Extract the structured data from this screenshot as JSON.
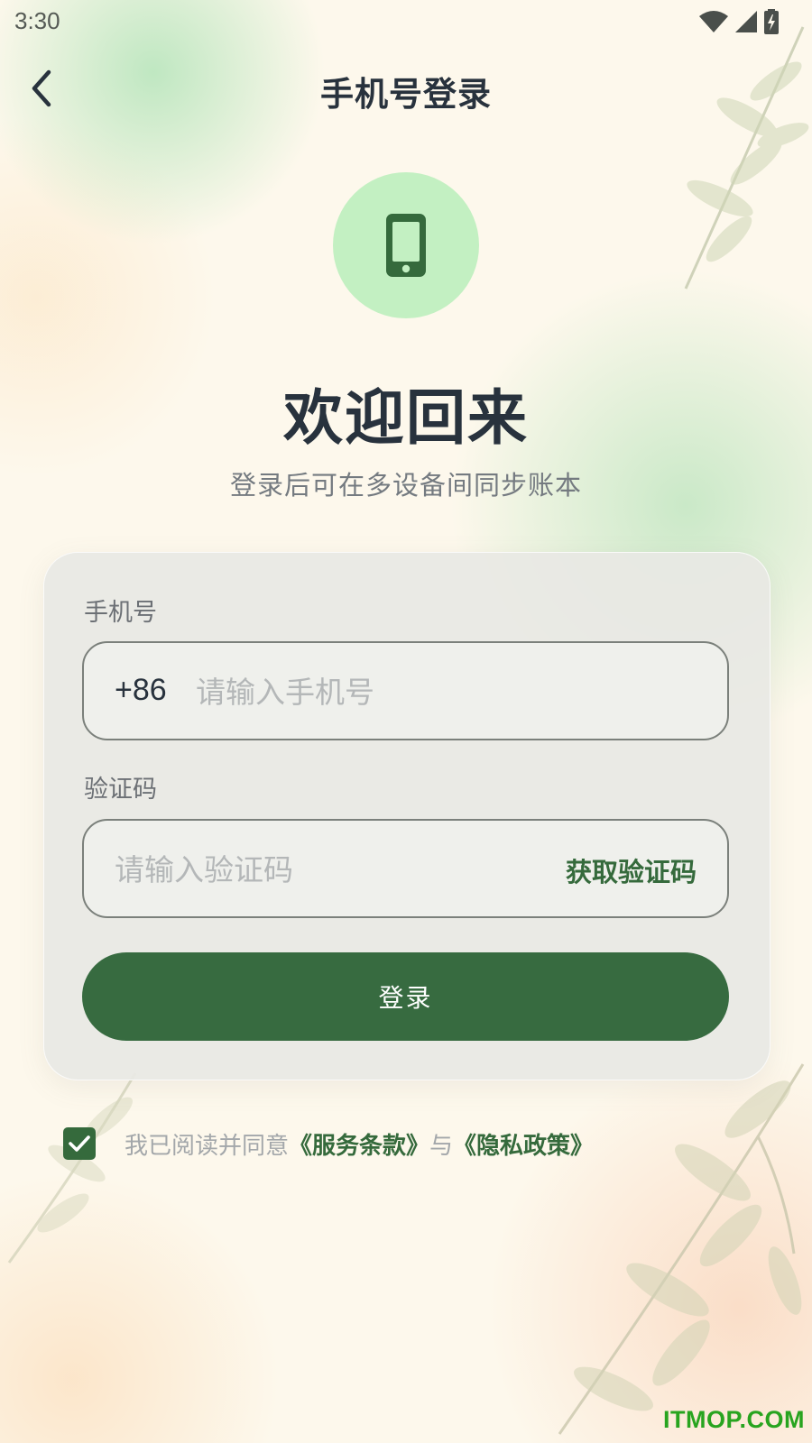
{
  "status_bar": {
    "time": "3:30",
    "icons": [
      "wifi-icon",
      "signal-icon",
      "battery-charging-icon"
    ]
  },
  "header": {
    "back_icon": "back-arrow-icon",
    "title": "手机号登录"
  },
  "hero": {
    "icon": "smartphone-icon",
    "title": "欢迎回来",
    "subtitle": "登录后可在多设备间同步账本"
  },
  "form": {
    "phone": {
      "label": "手机号",
      "country_code": "+86",
      "value": "",
      "placeholder": "请输入手机号"
    },
    "code": {
      "label": "验证码",
      "value": "",
      "placeholder": "请输入验证码",
      "get_code_label": "获取验证码"
    },
    "submit_label": "登录"
  },
  "agreement": {
    "checked": true,
    "prefix": "我已阅读并同意",
    "terms_link": "《服务条款》",
    "conjunction": "与",
    "privacy_link": "《隐私政策》"
  },
  "watermark": "ITMOP.COM",
  "colors": {
    "primary": "#376b40",
    "icon_circle": "#c3f0c2",
    "title_text": "#28323d",
    "muted_text": "#747a80",
    "watermark": "#28a41f"
  }
}
